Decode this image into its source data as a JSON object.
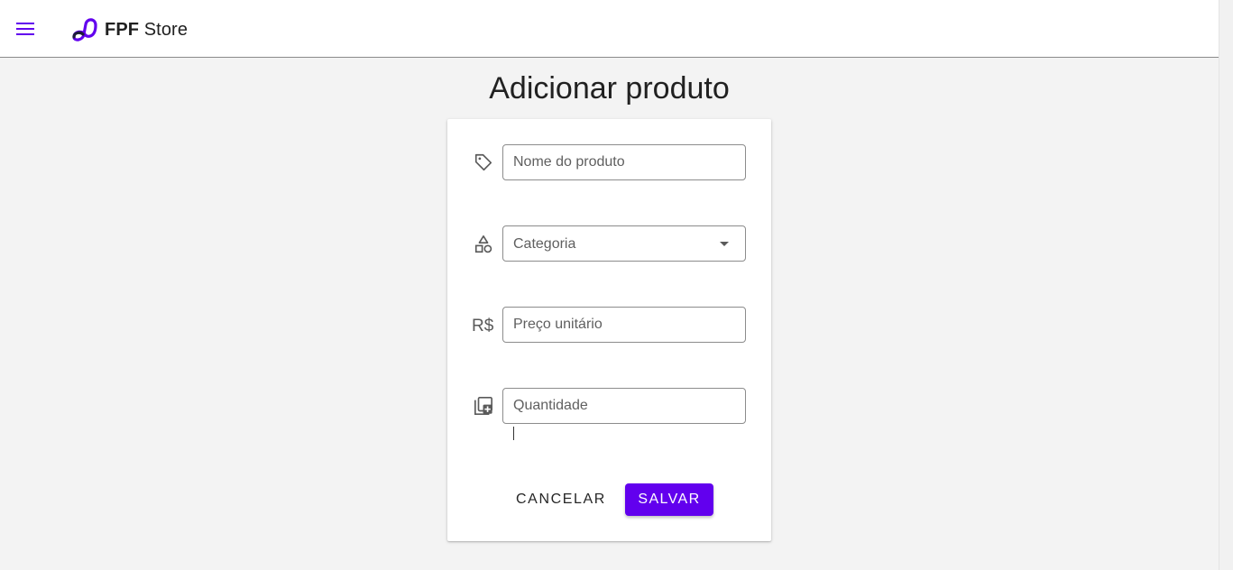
{
  "app_bar": {
    "brand_bold": "FPF",
    "brand_rest": " Store",
    "menu_icon": "menu-icon",
    "accent_color": "#6200ee"
  },
  "page": {
    "title": "Adicionar produto"
  },
  "form": {
    "name": {
      "icon": "tag-icon",
      "placeholder": "Nome do produto",
      "value": ""
    },
    "category": {
      "icon": "shapes-icon",
      "placeholder": "Categoria",
      "value": ""
    },
    "price": {
      "icon": "currency-real-icon",
      "placeholder": "Preço unitário",
      "value": ""
    },
    "quantity": {
      "icon": "library-add-icon",
      "placeholder": "Quantidade",
      "value": ""
    },
    "cancel_label": "CANCELAR",
    "save_label": "SALVAR"
  }
}
